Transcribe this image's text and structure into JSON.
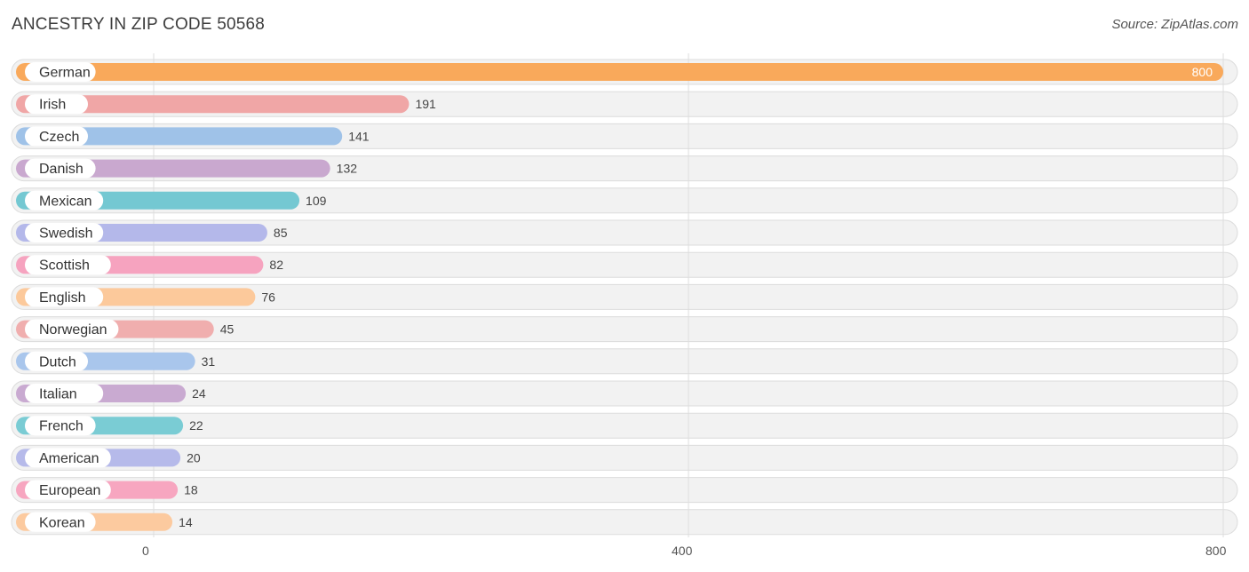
{
  "header": {
    "title": "ANCESTRY IN ZIP CODE 50568",
    "source": "Source: ZipAtlas.com"
  },
  "chart_data": {
    "type": "bar",
    "orientation": "horizontal",
    "title": "ANCESTRY IN ZIP CODE 50568",
    "categories": [
      "German",
      "Irish",
      "Czech",
      "Danish",
      "Mexican",
      "Swedish",
      "Scottish",
      "English",
      "Norwegian",
      "Dutch",
      "Italian",
      "French",
      "American",
      "European",
      "Korean"
    ],
    "values": [
      800,
      191,
      141,
      132,
      109,
      85,
      82,
      76,
      45,
      31,
      24,
      22,
      20,
      18,
      14
    ],
    "colors": [
      "#f9a95b",
      "#f0a6a6",
      "#9fc2e8",
      "#c9a8cf",
      "#74c8d2",
      "#b4b8ea",
      "#f6a3bf",
      "#fcc99b",
      "#f0aeae",
      "#a9c6ec",
      "#c9aad1",
      "#7accd4",
      "#b6baea",
      "#f7a6c0",
      "#fcca9f"
    ],
    "xlim": [
      0,
      800
    ],
    "xticks": [
      0,
      400,
      800
    ],
    "grid": true
  }
}
